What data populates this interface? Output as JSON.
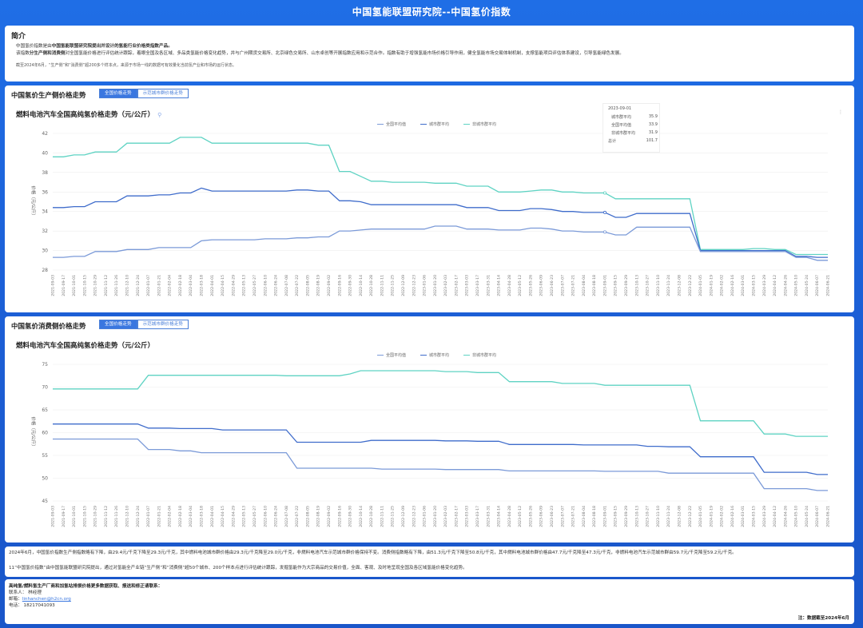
{
  "page_title": "中国氢能联盟研究院--中国氢价指数",
  "intro": {
    "title": "简介",
    "line1_pre": "中国氢价指数是由",
    "line1_bold": "中国氢能联盟研究院提出并设计的氢能行业价格类指数产品。",
    "line2_pre": "该指数",
    "line2_bold1": "分生产侧和消费侧",
    "line2_mid": "对全国氢能价格进行评估统计跟踪，着眼全国及各区域、多品类氢能价格变化趋势，并与广州期货交易所、北京绿色交易所、山东卓创等开展指数应用和示范合作。指数有助于增强氢能市场价格引导作用，健全氢能市场交易体制机制，支撑氢能项目评估体系建设，引导氢能绿色发展。",
    "line3": "截至2024年6月，“生产侧”和“消费侧”超200多个样本点，来源于市场一线的数据可有效量化当前氢产业和市场的运行状态。"
  },
  "section1": {
    "title": "中国氢价生产侧价格走势",
    "tab_active": "全国价格走势",
    "tab_other": "示范城市群价格走势",
    "chart_title": "燃料电池汽车全国高纯氢价格走势（元/公斤）",
    "link_icon": "link-icon",
    "tooltip": {
      "date": "2023-09-01",
      "rows": [
        {
          "label": "城市群平均",
          "value": "35.9"
        },
        {
          "label": "全国平均值",
          "value": "33.9"
        },
        {
          "label": "非城市群平均",
          "value": "31.9"
        },
        {
          "label": "总计",
          "value": "101.7"
        }
      ]
    },
    "kebab": "⋮"
  },
  "section2": {
    "title": "中国氢价消费侧价格走势",
    "tab_active": "全国价格走势",
    "tab_other": "示范城市群价格走势",
    "chart_title": "燃料电池汽车全国高纯氢价格走势（元/公斤）"
  },
  "note": {
    "n1": "2024年6月，中国氢价指数生产侧指数略有下降，由29.4元/千克下降至29.3元/千克，其中燃料电池城市群价格由29.3元/千克降至29.0元/千克，非燃料电池汽车示范城市群价格保持不变。消费侧指数略有下降，由51.3元/千克下降至50.8元/千克，其中燃料电池城市群价格由47.7元/千克降至47.3元/千克，非燃料电池汽车示范城市群由59.7元/千克降至59.2元/千克。",
    "n2": "11“中国氢价指数”由中国氢能联盟研究院提出，通过对氢能全产业链“生产侧”和“消费侧”超50个城市、200个样本点进行评估统计跟踪，发掘氢能作为大宗商品的交易价值，全面、客观、及时地呈现全国及各区域氢能价格变化趋势。"
  },
  "contact": {
    "c1": "高纯氢/燃料氢生产厂商和加氢站排损价格更多数据获取、报送和修正请联系：",
    "c2": "联系人：  林经理",
    "c3_label": "邮箱：",
    "c3_email": "linhanchen@h2cn.org",
    "c4": "电话：  18217041093",
    "c5": "注：数据截至2024年6月"
  },
  "colors": {
    "national": "#7b9ad8",
    "city": "#3f6ccb",
    "noncity": "#5fd3c3",
    "accent": "#3a77e0"
  },
  "chart_data": [
    {
      "type": "line",
      "title": "燃料电池汽车全国高纯氢价格走势（元/公斤）",
      "ylabel": "价格（元/公斤）",
      "ylim": [
        28,
        42
      ],
      "yticks": [
        28,
        30,
        32,
        34,
        36,
        38,
        40,
        42
      ],
      "xlabels": [
        "2021-09-03",
        "2021-09-17",
        "2021-10-01",
        "2021-10-15",
        "2021-10-29",
        "2021-11-12",
        "2021-11-26",
        "2021-12-10",
        "2021-12-24",
        "2022-01-07",
        "2022-01-21",
        "2022-02-04",
        "2022-02-18",
        "2022-03-04",
        "2022-03-18",
        "2022-04-01",
        "2022-04-15",
        "2022-04-29",
        "2022-05-13",
        "2022-05-27",
        "2022-06-10",
        "2022-06-24",
        "2022-07-08",
        "2022-07-22",
        "2022-08-05",
        "2022-08-19",
        "2022-09-02",
        "2022-09-16",
        "2022-09-30",
        "2022-10-14",
        "2022-10-28",
        "2022-11-11",
        "2022-11-25",
        "2022-12-09",
        "2022-12-23",
        "2023-01-06",
        "2023-01-20",
        "2023-02-03",
        "2023-02-17",
        "2023-03-03",
        "2023-03-17",
        "2023-03-31",
        "2023-04-14",
        "2023-04-28",
        "2023-05-12",
        "2023-05-26",
        "2023-06-09",
        "2023-06-23",
        "2023-07-07",
        "2023-07-21",
        "2023-08-04",
        "2023-08-18",
        "2023-09-01",
        "2023-09-15",
        "2023-09-29",
        "2023-10-13",
        "2023-10-27",
        "2023-11-10",
        "2023-11-24",
        "2023-12-08",
        "2023-12-22",
        "2024-01-05",
        "2024-01-19",
        "2024-02-02",
        "2024-02-16",
        "2024-03-01",
        "2024-03-15",
        "2024-03-29",
        "2024-04-12",
        "2024-04-26",
        "2024-05-10",
        "2024-05-24",
        "2024-06-07",
        "2024-06-21"
      ],
      "legend": [
        "全国平均值",
        "城市群平均",
        "非城市群平均"
      ],
      "series": [
        {
          "name": "城市群平均",
          "color_key": "noncity",
          "values": [
            39.6,
            39.6,
            39.8,
            39.8,
            40.1,
            40.1,
            40.1,
            41.0,
            41.0,
            41.0,
            41.0,
            41.0,
            41.6,
            41.6,
            41.6,
            41.0,
            41.0,
            41.0,
            41.0,
            41.0,
            41.0,
            41.0,
            41.0,
            41.0,
            41.0,
            40.8,
            40.8,
            38.1,
            38.1,
            37.6,
            37.1,
            37.1,
            37.0,
            37.0,
            37.0,
            37.0,
            36.9,
            36.9,
            36.9,
            36.6,
            36.6,
            36.6,
            36.0,
            36.0,
            36.0,
            36.1,
            36.2,
            36.2,
            36.0,
            36.0,
            35.9,
            35.9,
            35.9,
            35.3,
            35.3,
            35.3,
            35.3,
            35.3,
            35.3,
            35.3,
            35.3,
            30.1,
            30.1,
            30.1,
            30.1,
            30.1,
            30.2,
            30.2,
            30.1,
            30.1,
            29.6,
            29.6,
            29.6,
            29.6
          ]
        },
        {
          "name": "全国平均值",
          "color_key": "city",
          "values": [
            34.4,
            34.4,
            34.5,
            34.5,
            35.0,
            35.0,
            35.0,
            35.6,
            35.6,
            35.6,
            35.7,
            35.7,
            35.9,
            35.9,
            36.4,
            36.1,
            36.1,
            36.1,
            36.1,
            36.1,
            36.1,
            36.1,
            36.1,
            36.2,
            36.2,
            36.1,
            36.1,
            35.1,
            35.1,
            35.0,
            34.7,
            34.7,
            34.7,
            34.7,
            34.7,
            34.7,
            34.7,
            34.7,
            34.7,
            34.4,
            34.4,
            34.4,
            34.1,
            34.1,
            34.1,
            34.3,
            34.3,
            34.2,
            34.0,
            34.0,
            33.9,
            33.9,
            33.9,
            33.4,
            33.4,
            33.8,
            33.8,
            33.8,
            33.8,
            33.8,
            33.8,
            30.0,
            30.0,
            30.0,
            30.0,
            30.0,
            30.0,
            30.0,
            30.0,
            30.0,
            29.4,
            29.4,
            29.3,
            29.3
          ]
        },
        {
          "name": "非城市群平均",
          "color_key": "national",
          "values": [
            29.3,
            29.3,
            29.4,
            29.4,
            29.9,
            29.9,
            29.9,
            30.1,
            30.1,
            30.1,
            30.3,
            30.3,
            30.3,
            30.3,
            31.0,
            31.1,
            31.1,
            31.1,
            31.1,
            31.1,
            31.2,
            31.2,
            31.2,
            31.3,
            31.3,
            31.4,
            31.4,
            32.0,
            32.0,
            32.1,
            32.2,
            32.2,
            32.2,
            32.2,
            32.2,
            32.2,
            32.5,
            32.5,
            32.5,
            32.2,
            32.2,
            32.2,
            32.1,
            32.1,
            32.1,
            32.3,
            32.3,
            32.2,
            32.0,
            32.0,
            31.9,
            31.9,
            31.9,
            31.6,
            31.6,
            32.4,
            32.4,
            32.4,
            32.4,
            32.4,
            32.4,
            29.9,
            29.9,
            29.9,
            29.9,
            29.9,
            29.9,
            29.9,
            29.9,
            29.9,
            29.3,
            29.3,
            29.0,
            29.0
          ]
        }
      ]
    },
    {
      "type": "line",
      "title": "燃料电池汽车全国高纯氢价格走势（元/公斤）",
      "ylabel": "价格（元/公斤）",
      "ylim": [
        45,
        75
      ],
      "yticks": [
        45,
        50,
        55,
        60,
        65,
        70,
        75
      ],
      "xlabels": [
        "2021-09-03",
        "2021-09-17",
        "2021-10-01",
        "2021-10-15",
        "2021-10-29",
        "2021-11-12",
        "2021-11-26",
        "2021-12-10",
        "2021-12-24",
        "2022-01-07",
        "2022-01-21",
        "2022-02-04",
        "2022-02-18",
        "2022-03-04",
        "2022-03-18",
        "2022-04-01",
        "2022-04-15",
        "2022-04-29",
        "2022-05-13",
        "2022-05-27",
        "2022-06-10",
        "2022-06-24",
        "2022-07-08",
        "2022-07-22",
        "2022-08-05",
        "2022-08-19",
        "2022-09-02",
        "2022-09-16",
        "2022-09-30",
        "2022-10-14",
        "2022-10-28",
        "2022-11-11",
        "2022-11-25",
        "2022-12-09",
        "2022-12-23",
        "2023-01-06",
        "2023-01-20",
        "2023-02-03",
        "2023-02-17",
        "2023-03-03",
        "2023-03-17",
        "2023-03-31",
        "2023-04-14",
        "2023-04-28",
        "2023-05-12",
        "2023-05-26",
        "2023-06-09",
        "2023-06-23",
        "2023-07-07",
        "2023-07-21",
        "2023-08-04",
        "2023-08-18",
        "2023-09-01",
        "2023-09-15",
        "2023-09-29",
        "2023-10-13",
        "2023-10-27",
        "2023-11-10",
        "2023-11-24",
        "2023-12-08",
        "2023-12-22",
        "2024-01-05",
        "2024-01-19",
        "2024-02-02",
        "2024-02-16",
        "2024-03-01",
        "2024-03-15",
        "2024-03-29",
        "2024-04-12",
        "2024-04-26",
        "2024-05-10",
        "2024-05-24",
        "2024-06-07",
        "2024-06-21"
      ],
      "legend": [
        "全国平均值",
        "城市群平均",
        "非城市群平均"
      ],
      "series": [
        {
          "name": "非城市群平均",
          "color_key": "noncity",
          "values": [
            69.6,
            69.6,
            69.6,
            69.6,
            69.6,
            69.6,
            69.6,
            69.6,
            69.6,
            72.6,
            72.6,
            72.6,
            72.6,
            72.6,
            72.6,
            72.6,
            72.6,
            72.6,
            72.6,
            72.6,
            72.6,
            72.6,
            72.5,
            72.5,
            72.5,
            72.5,
            72.5,
            72.5,
            72.9,
            73.6,
            73.6,
            73.6,
            73.6,
            73.6,
            73.6,
            73.6,
            73.6,
            73.4,
            73.4,
            73.4,
            73.2,
            73.2,
            73.2,
            71.2,
            71.2,
            71.2,
            71.2,
            71.2,
            70.8,
            70.8,
            70.8,
            70.8,
            70.4,
            70.4,
            70.4,
            70.4,
            70.4,
            70.4,
            70.4,
            70.4,
            70.4,
            62.6,
            62.6,
            62.6,
            62.6,
            62.6,
            62.6,
            59.7,
            59.7,
            59.7,
            59.2,
            59.2,
            59.2,
            59.2
          ]
        },
        {
          "name": "全国平均值",
          "color_key": "city",
          "values": [
            61.9,
            61.9,
            61.9,
            61.9,
            61.9,
            61.9,
            61.9,
            61.9,
            61.9,
            61.0,
            61.0,
            61.0,
            60.9,
            60.9,
            60.9,
            60.9,
            60.6,
            60.6,
            60.6,
            60.6,
            60.6,
            60.6,
            60.6,
            57.9,
            57.9,
            57.9,
            57.9,
            57.9,
            57.9,
            57.9,
            58.3,
            58.3,
            58.3,
            58.3,
            58.3,
            58.3,
            58.3,
            58.2,
            58.2,
            58.2,
            58.1,
            58.1,
            58.1,
            57.4,
            57.4,
            57.4,
            57.4,
            57.4,
            57.4,
            57.4,
            57.3,
            57.3,
            57.3,
            57.3,
            57.3,
            57.3,
            57.0,
            57.0,
            56.9,
            56.9,
            56.9,
            54.7,
            54.7,
            54.7,
            54.7,
            54.7,
            54.7,
            51.3,
            51.3,
            51.3,
            51.3,
            51.3,
            50.8,
            50.8
          ]
        },
        {
          "name": "城市群平均",
          "color_key": "national",
          "values": [
            58.6,
            58.6,
            58.6,
            58.6,
            58.6,
            58.6,
            58.6,
            58.6,
            58.6,
            56.3,
            56.3,
            56.3,
            56.0,
            56.0,
            55.6,
            55.6,
            55.6,
            55.6,
            55.6,
            55.6,
            55.6,
            55.6,
            55.6,
            52.2,
            52.2,
            52.2,
            52.2,
            52.2,
            52.2,
            52.2,
            52.2,
            52.0,
            52.0,
            52.0,
            52.0,
            52.0,
            52.0,
            51.9,
            51.9,
            51.9,
            51.9,
            51.9,
            51.9,
            51.6,
            51.6,
            51.6,
            51.6,
            51.6,
            51.6,
            51.6,
            51.6,
            51.6,
            51.5,
            51.5,
            51.5,
            51.5,
            51.5,
            51.5,
            51.1,
            51.1,
            51.1,
            51.1,
            51.1,
            51.1,
            51.1,
            51.1,
            51.1,
            47.7,
            47.7,
            47.7,
            47.7,
            47.7,
            47.3,
            47.3
          ]
        }
      ]
    }
  ]
}
